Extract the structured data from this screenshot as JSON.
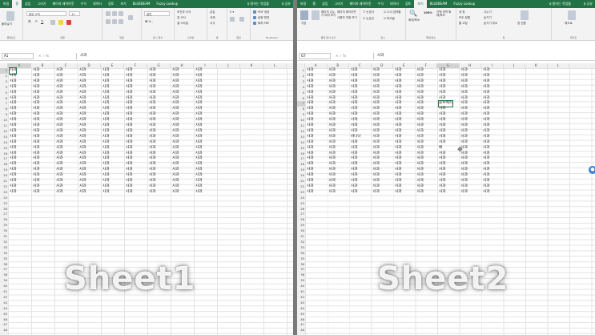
{
  "tabs": [
    "파일",
    "홈",
    "삽입",
    "그리기",
    "페이지 레이아웃",
    "수식",
    "데이터",
    "검토",
    "보기",
    "BLUEBEAM",
    "Fuzzy Lookup"
  ],
  "tab_search": "♀ 원하는 작업을",
  "tab_share": "♀ 공유",
  "left": {
    "active_tab": 1,
    "ribbon": {
      "clipboard_label": "클립보드",
      "font_label": "글꼴",
      "align_label": "맞춤",
      "number_label": "표시 형식",
      "styles_label": "스타일",
      "cells_label": "셀",
      "edit_label": "편집",
      "bluebeam_label": "Bluebeam",
      "paste": "붙여넣기",
      "font_name": "맑은 고딕",
      "font_size": "11",
      "number_format": "일반",
      "cond_format": "조건부 서식",
      "table_format": "표 서식",
      "cell_style": "셀 스타일",
      "insert": "삽입",
      "delete": "삭제",
      "format": "서식",
      "create_pdf": "PDF 생성",
      "settings": "설정 변경",
      "batch_pdf": "배치 PDF"
    },
    "namebox": "A1",
    "formula": "사과",
    "columns": [
      "A",
      "B",
      "C",
      "D",
      "E",
      "F",
      "G",
      "H",
      "I",
      "J",
      "K",
      "L"
    ],
    "rows": [
      "1",
      "2",
      "3",
      "4",
      "5",
      "6",
      "7",
      "8",
      "9",
      "10",
      "11",
      "12",
      "13",
      "14",
      "15",
      "16",
      "17",
      "18",
      "19",
      "20",
      "21",
      "22",
      "23",
      "24",
      "25",
      "26",
      "27",
      "28",
      "29",
      "30",
      "31",
      "32",
      "33",
      "34",
      "35",
      "36",
      "37",
      "38",
      "39",
      "40",
      "41",
      "42",
      "43",
      "44",
      "45",
      "46",
      "47",
      "48"
    ],
    "cell_text": "사과",
    "filled_rows": 23,
    "filled_cols": 9,
    "overlay": "Sheet1"
  },
  "right": {
    "active_tab": 8,
    "ribbon": {
      "views_label": "통합 문서 보기",
      "show_label": "표시",
      "zoom_label": "확대/축소",
      "window_label": "창",
      "macro_label": "매크로",
      "normal": "기본",
      "page_break": "페이지 나누기 미리 보기",
      "page_layout": "페이지 레이아웃",
      "custom_view": "사용자 지정 보기",
      "ruler": "눈금자",
      "gridlines": "눈금선",
      "formula_bar": "수식 입력줄",
      "headings": "머리글",
      "zoom": "확대/축소",
      "zoom_100": "100%",
      "zoom_sel": "선택 영역 확대/축소",
      "new_window": "새 창",
      "arrange": "모두 정렬",
      "freeze": "틀 고정",
      "split": "나누기",
      "hide": "숨기기",
      "unhide": "숨기기 취소",
      "switch": "창 전환",
      "macros": "매크로"
    },
    "namebox": "G7",
    "formula": "사과",
    "columns": [
      "A",
      "B",
      "C",
      "D",
      "E",
      "F",
      "G",
      "H",
      "I",
      "J",
      "K",
      "L"
    ],
    "rows": [
      "1",
      "2",
      "3",
      "4",
      "5",
      "6",
      "7",
      "8",
      "9",
      "10",
      "11",
      "12",
      "13",
      "14",
      "15",
      "16",
      "17",
      "18",
      "19",
      "20",
      "21",
      "22",
      "23",
      "24",
      "25",
      "26",
      "27",
      "28",
      "29",
      "30",
      "31",
      "32",
      "33",
      "34",
      "35",
      "36",
      "37",
      "38",
      "39",
      "40",
      "41",
      "42",
      "43",
      "44",
      "45",
      "46",
      "47",
      "48"
    ],
    "cell_text": "사과",
    "filled_rows": 23,
    "filled_cols": 9,
    "exceptions": [
      {
        "row": 6,
        "col": 6,
        "text": "블루베리"
      },
      {
        "row": 12,
        "col": 2,
        "text": "바나나"
      },
      {
        "row": 14,
        "col": 6,
        "text": "배"
      }
    ],
    "overlay": "Sheet2"
  }
}
